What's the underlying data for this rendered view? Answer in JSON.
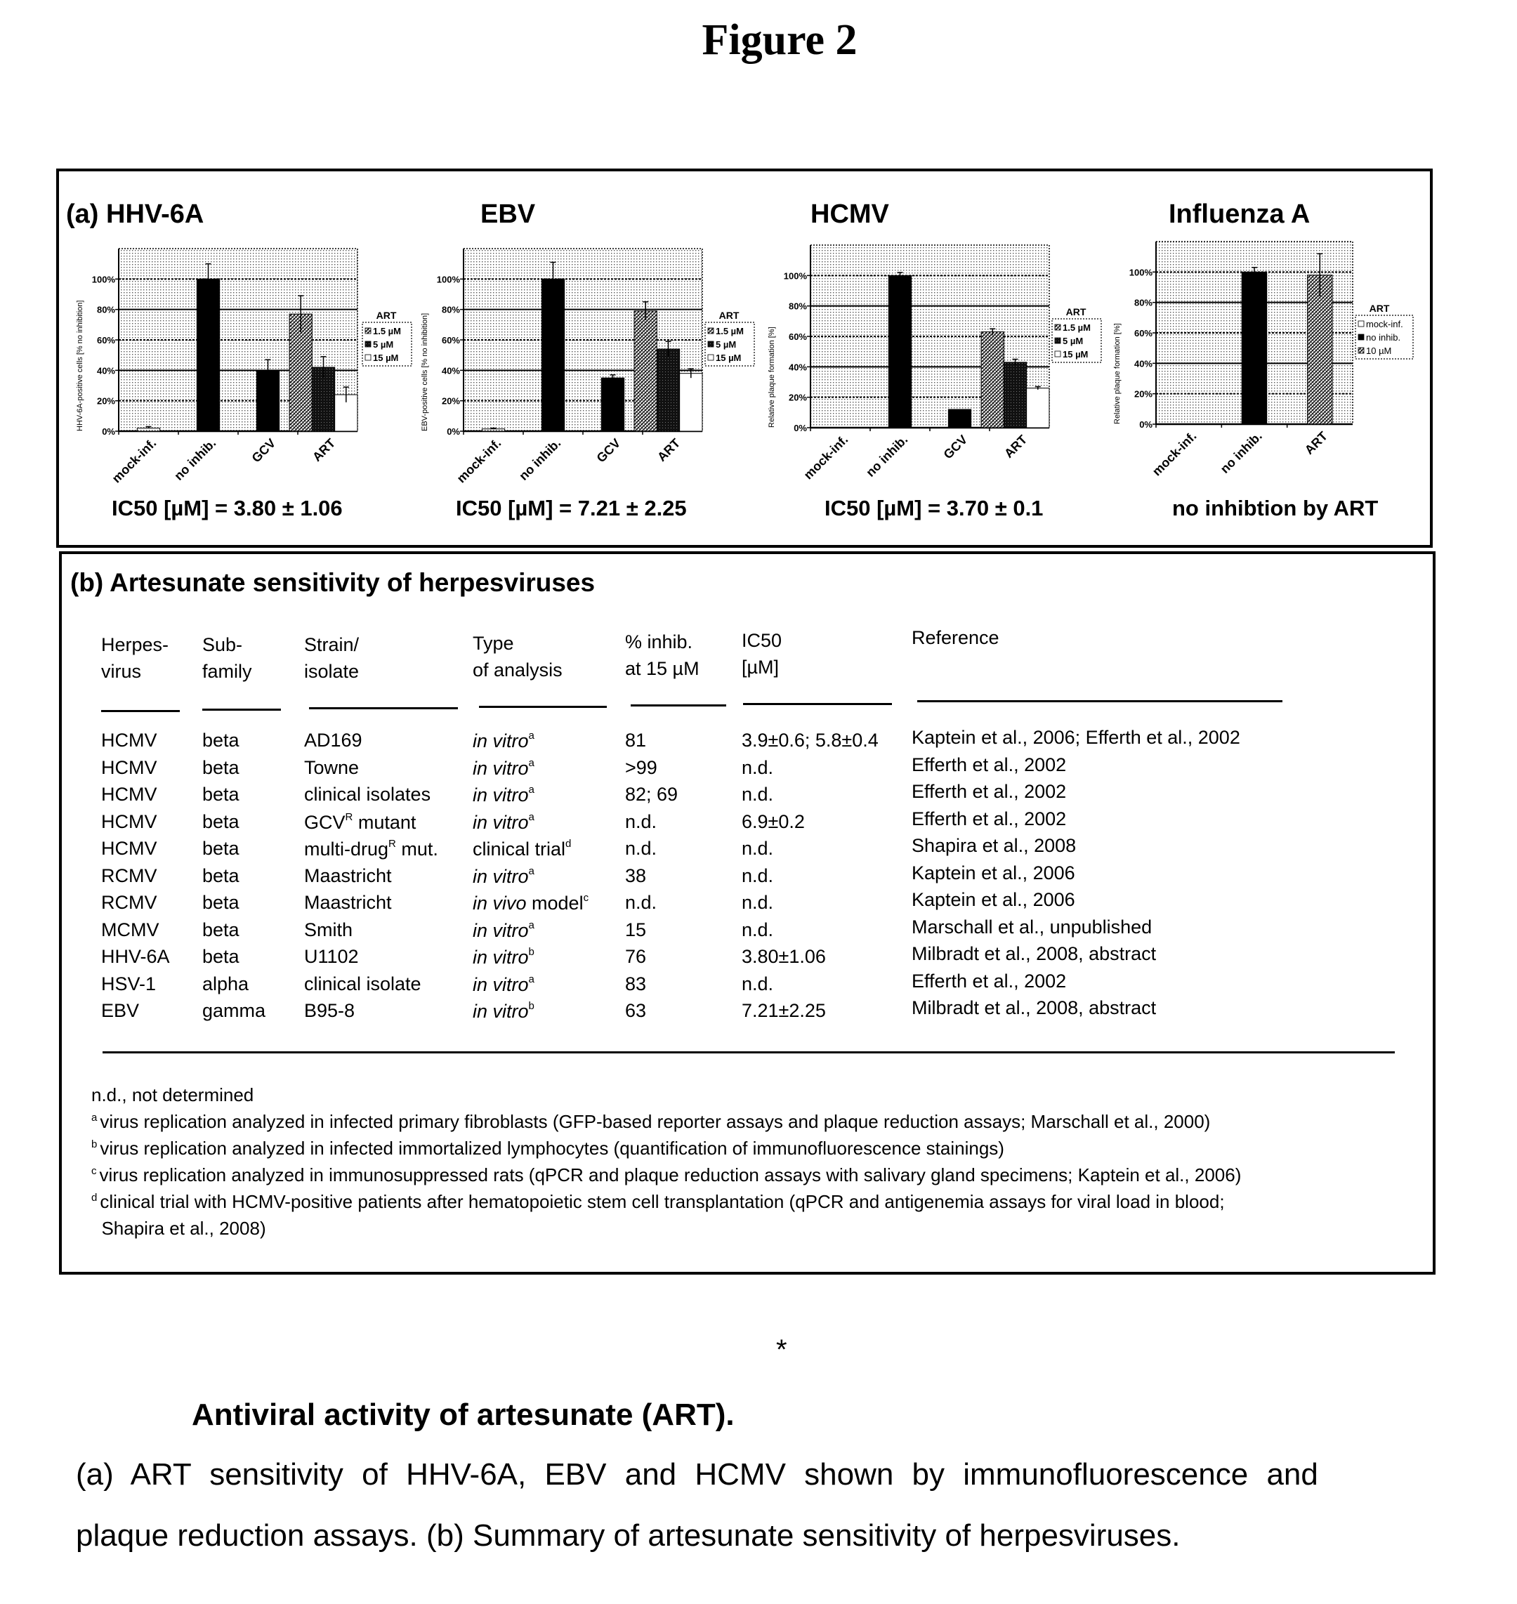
{
  "figure_title": "Figure 2",
  "chart_data": [
    {
      "type": "bar",
      "panel_label": "(a) HHV-6A",
      "title": "HHV-6A",
      "ylabel": "HHV-6A-positive cells [% no inhibition]",
      "xlabel": "",
      "ylim": [
        0,
        120
      ],
      "yticks": [
        "0%",
        "20%",
        "40%",
        "60%",
        "80%",
        "100%"
      ],
      "ytick_values": [
        0,
        20,
        40,
        60,
        80,
        100
      ],
      "grid": true,
      "categories": [
        "mock-inf.",
        "no inhib.",
        "GCV",
        "ART"
      ],
      "bars": [
        {
          "category": "mock-inf.",
          "value": 2,
          "error": 1,
          "fill": "dots"
        },
        {
          "category": "no inhib.",
          "value": 100,
          "error": 10,
          "fill": "black"
        },
        {
          "category": "GCV",
          "value": 40,
          "error": 7,
          "fill": "black"
        },
        {
          "category": "ART",
          "series": "1.5 µM",
          "value": 77,
          "error": 12,
          "fill": "hatch"
        },
        {
          "category": "ART",
          "series": "5 µM",
          "value": 42,
          "error": 7,
          "fill": "dark"
        },
        {
          "category": "ART",
          "series": "15 µM",
          "value": 24,
          "error": 5,
          "fill": "white"
        }
      ],
      "legend": {
        "title": "ART",
        "position": "right",
        "entries": [
          "1.5 µM",
          "5 µM",
          "15 µM"
        ],
        "fills": [
          "hatch",
          "dark",
          "white"
        ]
      },
      "annotation": "IC50 [µM] = 3.80 ± 1.06"
    },
    {
      "type": "bar",
      "title": "EBV",
      "ylabel": "EBV-positive cells [% no inhibition]",
      "xlabel": "",
      "ylim": [
        0,
        120
      ],
      "yticks": [
        "0%",
        "20%",
        "40%",
        "60%",
        "80%",
        "100%"
      ],
      "ytick_values": [
        0,
        20,
        40,
        60,
        80,
        100
      ],
      "grid": true,
      "categories": [
        "mock-inf.",
        "no inhib.",
        "GCV",
        "ART"
      ],
      "bars": [
        {
          "category": "mock-inf.",
          "value": 1.5,
          "error": 0.5,
          "fill": "dots"
        },
        {
          "category": "no inhib.",
          "value": 100,
          "error": 11,
          "fill": "black"
        },
        {
          "category": "GCV",
          "value": 35,
          "error": 2,
          "fill": "black"
        },
        {
          "category": "ART",
          "series": "1.5 µM",
          "value": 79,
          "error": 6,
          "fill": "hatch"
        },
        {
          "category": "ART",
          "series": "5 µM",
          "value": 54,
          "error": 5,
          "fill": "dark"
        },
        {
          "category": "ART",
          "series": "15 µM",
          "value": 38,
          "error": 3,
          "fill": "white"
        }
      ],
      "legend": {
        "title": "ART",
        "position": "right",
        "entries": [
          "1.5 µM",
          "5 µM",
          "15 µM"
        ],
        "fills": [
          "hatch",
          "dark",
          "white"
        ]
      },
      "annotation": "IC50 [µM] = 7.21 ± 2.25"
    },
    {
      "type": "bar",
      "title": "HCMV",
      "ylabel": "Relative plaque formation [%]",
      "xlabel": "",
      "ylim": [
        0,
        120
      ],
      "yticks": [
        "0%",
        "20%",
        "40%",
        "60%",
        "80%",
        "100%"
      ],
      "ytick_values": [
        0,
        20,
        40,
        60,
        80,
        100
      ],
      "grid": true,
      "categories": [
        "mock-inf.",
        "no inhib.",
        "GCV",
        "ART"
      ],
      "bars": [
        {
          "category": "mock-inf.",
          "value": 0,
          "error": 0,
          "fill": "dots"
        },
        {
          "category": "no inhib.",
          "value": 100,
          "error": 2,
          "fill": "black"
        },
        {
          "category": "GCV",
          "value": 12,
          "error": 0,
          "fill": "black"
        },
        {
          "category": "ART",
          "series": "1.5 µM",
          "value": 63,
          "error": 2,
          "fill": "hatch"
        },
        {
          "category": "ART",
          "series": "5 µM",
          "value": 43,
          "error": 2,
          "fill": "dark"
        },
        {
          "category": "ART",
          "series": "15 µM",
          "value": 26,
          "error": 1,
          "fill": "white"
        }
      ],
      "legend": {
        "title": "ART",
        "position": "right",
        "entries": [
          "1.5 µM",
          "5 µM",
          "15 µM"
        ],
        "fills": [
          "hatch",
          "dark",
          "white"
        ]
      },
      "annotation": "IC50 [µM] = 3.70 ± 0.1"
    },
    {
      "type": "bar",
      "title": "Influenza A",
      "ylabel": "Relative plaque formation [%]",
      "xlabel": "",
      "ylim": [
        0,
        120
      ],
      "yticks": [
        "0%",
        "20%",
        "40%",
        "60%",
        "80%",
        "100%"
      ],
      "ytick_values": [
        0,
        20,
        40,
        60,
        80,
        100
      ],
      "grid": true,
      "categories": [
        "mock-inf.",
        "no inhib.",
        "ART"
      ],
      "bars": [
        {
          "category": "mock-inf.",
          "value": 0,
          "error": 0,
          "fill": "white"
        },
        {
          "category": "no inhib.",
          "value": 100,
          "error": 3,
          "fill": "black"
        },
        {
          "category": "ART",
          "series": "10 µM",
          "value": 98,
          "error": 14,
          "fill": "hatch"
        }
      ],
      "legend": {
        "title": "ART",
        "position": "right",
        "entries": [
          "mock-inf.",
          "no inhib.",
          "10 µM"
        ],
        "fills": [
          "white",
          "black",
          "hatch"
        ]
      },
      "annotation": "no inhibtion by ART"
    }
  ],
  "table": {
    "title": "(b) Artesunate sensitivity of herpesviruses",
    "headers": [
      [
        "Herpes-",
        "virus"
      ],
      [
        "Sub-",
        "family"
      ],
      [
        "Strain/",
        "isolate"
      ],
      [
        "Type",
        "of analysis"
      ],
      [
        "% inhib.",
        "at 15 µM"
      ],
      [
        "IC50",
        "[µM]"
      ],
      [
        "Reference",
        ""
      ]
    ],
    "rows": [
      {
        "virus": "HCMV",
        "subfamily": "beta",
        "strain": "AD169",
        "strain_sup": "",
        "strain_tail": "",
        "type": "in vitro",
        "type_italic": true,
        "type_tail": "",
        "type_sup": "a",
        "inhib": "81",
        "ic50": "3.9±0.6; 5.8±0.4",
        "reference": "Kaptein et al., 2006; Efferth et al., 2002"
      },
      {
        "virus": "HCMV",
        "subfamily": "beta",
        "strain": "Towne",
        "strain_sup": "",
        "strain_tail": "",
        "type": "in vitro",
        "type_italic": true,
        "type_tail": "",
        "type_sup": "a",
        "inhib": ">99",
        "ic50": "n.d.",
        "reference": "Efferth et al., 2002"
      },
      {
        "virus": "HCMV",
        "subfamily": "beta",
        "strain": "clinical isolates",
        "strain_sup": "",
        "strain_tail": "",
        "type": "in vitro",
        "type_italic": true,
        "type_tail": "",
        "type_sup": "a",
        "inhib": "82; 69",
        "ic50": "n.d.",
        "reference": "Efferth et al., 2002"
      },
      {
        "virus": "HCMV",
        "subfamily": "beta",
        "strain": "GCV",
        "strain_sup": "R",
        "strain_tail": " mutant",
        "type": "in vitro",
        "type_italic": true,
        "type_tail": "",
        "type_sup": "a",
        "inhib": "n.d.",
        "ic50": "6.9±0.2",
        "reference": "Efferth et al., 2002"
      },
      {
        "virus": "HCMV",
        "subfamily": "beta",
        "strain": "multi-drug",
        "strain_sup": "R",
        "strain_tail": " mut.",
        "type": "clinical trial",
        "type_italic": false,
        "type_tail": "",
        "type_sup": "d",
        "inhib": "n.d.",
        "ic50": "n.d.",
        "reference": "Shapira et al., 2008"
      },
      {
        "virus": "RCMV",
        "subfamily": "beta",
        "strain": "Maastricht",
        "strain_sup": "",
        "strain_tail": "",
        "type": "in vitro",
        "type_italic": true,
        "type_tail": "",
        "type_sup": "a",
        "inhib": "38",
        "ic50": "n.d.",
        "reference": "Kaptein et al., 2006"
      },
      {
        "virus": "RCMV",
        "subfamily": "beta",
        "strain": "Maastricht",
        "strain_sup": "",
        "strain_tail": "",
        "type": "in vivo",
        "type_italic": true,
        "type_tail": " model",
        "type_sup": "c",
        "inhib": "n.d.",
        "ic50": "n.d.",
        "reference": "Kaptein et al., 2006"
      },
      {
        "virus": "MCMV",
        "subfamily": "beta",
        "strain": "Smith",
        "strain_sup": "",
        "strain_tail": "",
        "type": "in vitro",
        "type_italic": true,
        "type_tail": "",
        "type_sup": "a",
        "inhib": "15",
        "ic50": "n.d.",
        "reference": "Marschall et al., unpublished"
      },
      {
        "virus": "HHV-6A",
        "subfamily": "beta",
        "strain": "U1102",
        "strain_sup": "",
        "strain_tail": "",
        "type": "in vitro",
        "type_italic": true,
        "type_tail": "",
        "type_sup": "b",
        "inhib": "76",
        "ic50": "3.80±1.06",
        "reference": "Milbradt et al., 2008, abstract"
      },
      {
        "virus": "HSV-1",
        "subfamily": "alpha",
        "strain": "clinical isolate",
        "strain_sup": "",
        "strain_tail": "",
        "type": "in vitro",
        "type_italic": true,
        "type_tail": "",
        "type_sup": "a",
        "inhib": "83",
        "ic50": "n.d.",
        "reference": "Efferth et al., 2002"
      },
      {
        "virus": "EBV",
        "subfamily": "gamma",
        "strain": "B95-8",
        "strain_sup": "",
        "strain_tail": "",
        "type": "in vitro",
        "type_italic": true,
        "type_tail": "",
        "type_sup": "b",
        "inhib": "63",
        "ic50": "7.21±2.25",
        "reference": "Milbradt et al., 2008, abstract"
      }
    ],
    "footnotes": [
      {
        "mark": "",
        "text": "n.d., not determined"
      },
      {
        "mark": "a",
        "text": "virus replication analyzed in infected primary fibroblasts (GFP-based reporter assays and plaque reduction assays; Marschall et al., 2000)"
      },
      {
        "mark": "b",
        "text": "virus replication analyzed in infected immortalized lymphocytes (quantification of immunofluorescence stainings)"
      },
      {
        "mark": "c",
        "text": "virus replication analyzed in immunosuppressed rats (qPCR and plaque reduction assays with salivary gland specimens; Kaptein et al., 2006)"
      },
      {
        "mark": "d",
        "text": "clinical trial with HCMV-positive patients after hematopoietic stem cell transplantation (qPCR and antigenemia assays for viral load in blood;"
      },
      {
        "mark": "",
        "text": "  Shapira et al., 2008)"
      }
    ]
  },
  "separator": "*",
  "caption": {
    "title": "Antiviral activity of artesunate (ART).",
    "line1": "(a) ART sensitivity of HHV-6A, EBV and HCMV shown by immunofluorescence and",
    "line2": "plaque reduction assays. (b) Summary of artesunate sensitivity of herpesviruses."
  }
}
